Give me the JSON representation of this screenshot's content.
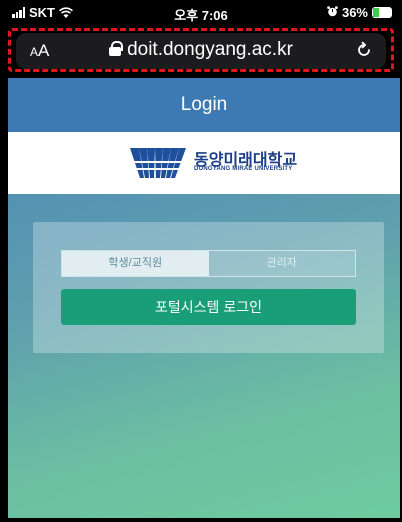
{
  "status_bar": {
    "carrier": "SKT",
    "time": "오후 7:06",
    "battery_percent": "36%",
    "battery_level": 0.36,
    "icons": [
      "signal-icon",
      "wifi-icon",
      "alarm-icon",
      "battery-icon"
    ]
  },
  "address_bar": {
    "aa_label_big": "A",
    "aa_label_small": "A",
    "url": "doit.dongyang.ac.kr",
    "lock_icon": "lock-icon",
    "reload_icon": "reload-icon"
  },
  "page": {
    "header_title": "Login",
    "logo": {
      "name_ko": "동양미래대학교",
      "name_en": "DONGYANG MIRAE UNIVERSITY"
    },
    "tabs": [
      {
        "label": "학생/교직원",
        "active": true
      },
      {
        "label": "관리자",
        "active": false
      }
    ],
    "portal_button_label": "포털시스템 로그인"
  },
  "colors": {
    "header_blue": "#3d79b3",
    "button_green": "#1a9e77",
    "highlight_red": "#e0161b",
    "logo_navy": "#1d3f87"
  }
}
